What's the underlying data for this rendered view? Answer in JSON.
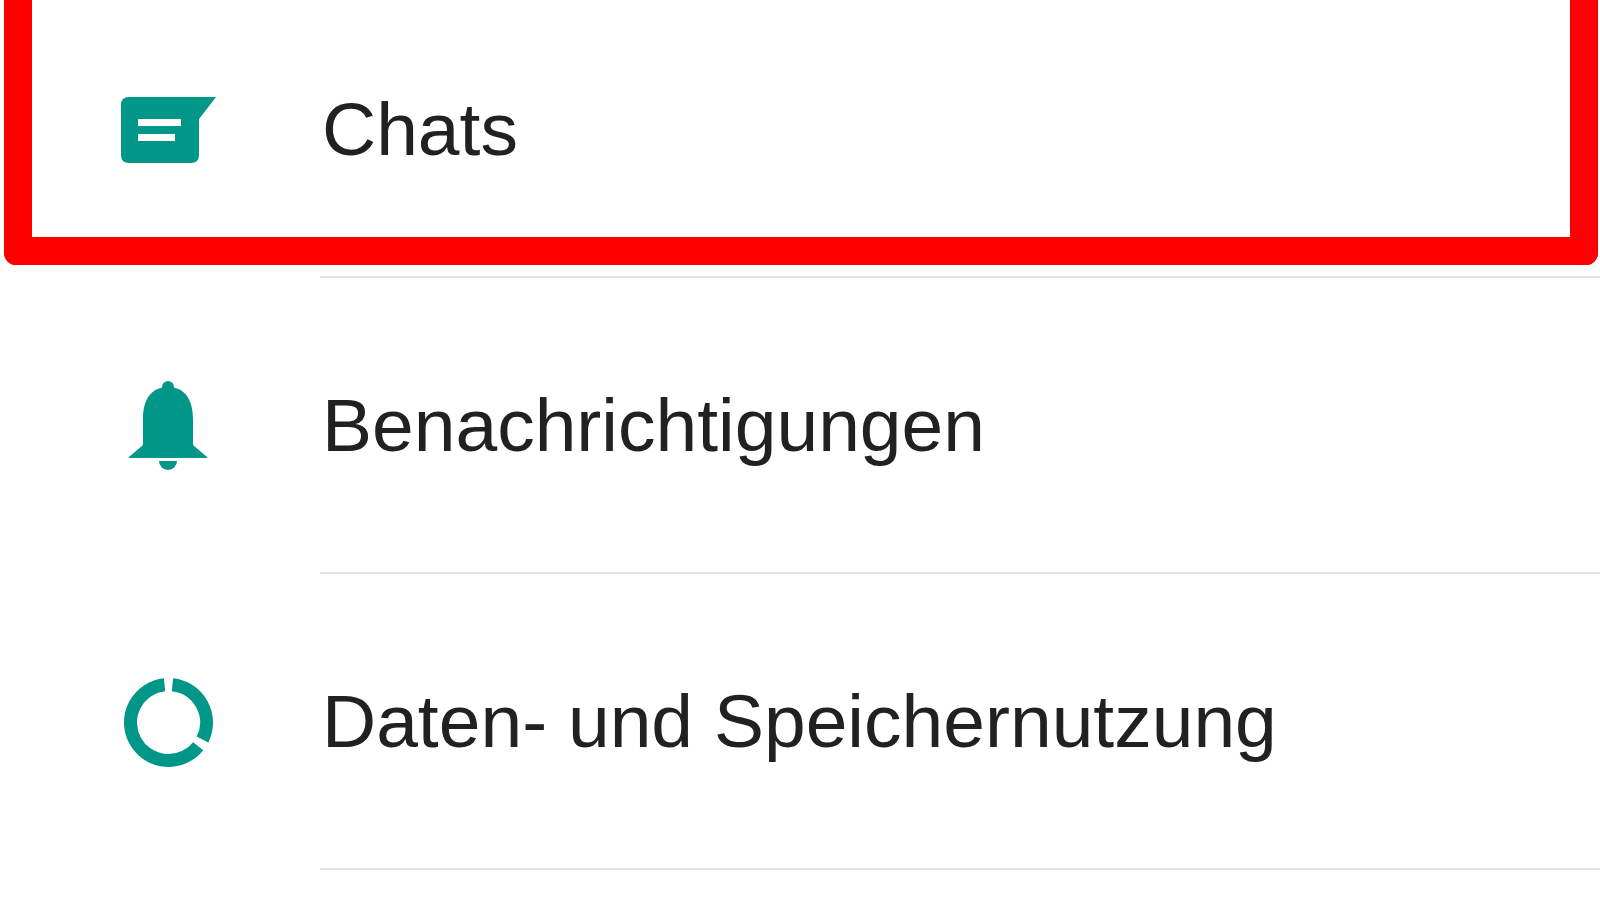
{
  "settings_list": {
    "items": [
      {
        "label": "Chats",
        "highlighted": true
      },
      {
        "label": "Benachrichtigungen",
        "highlighted": false
      },
      {
        "label": "Daten- und Speichernutzung",
        "highlighted": false
      }
    ]
  }
}
